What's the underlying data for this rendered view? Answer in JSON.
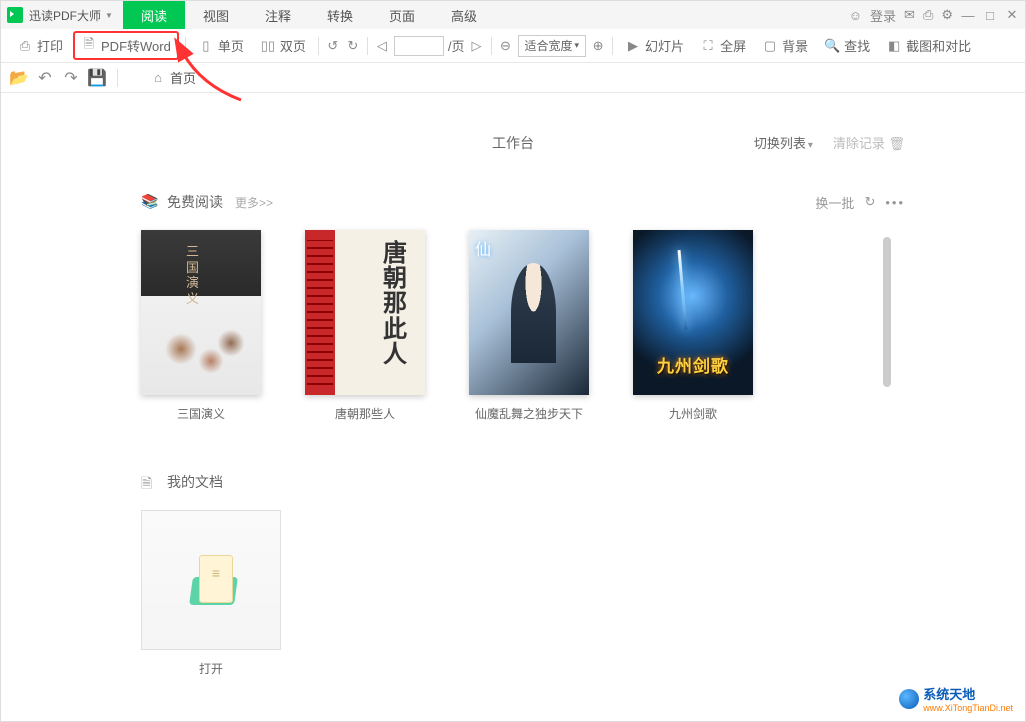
{
  "title_bar": {
    "app_name": "迅读PDF大师",
    "menu": [
      "阅读",
      "视图",
      "注释",
      "转换",
      "页面",
      "高级"
    ],
    "active_menu_index": 0,
    "login_label": "登录"
  },
  "toolbar": {
    "print": "打印",
    "pdf_to_word": "PDF转Word",
    "single_page": "单页",
    "double_page": "双页",
    "page_sep": "/页",
    "fit_width": "适合宽度",
    "slideshow": "幻灯片",
    "fullscreen": "全屏",
    "background": "背景",
    "find": "查找",
    "screenshot_compare": "截图和对比"
  },
  "sec_toolbar": {
    "home_tab": "首页"
  },
  "workspace": {
    "title": "工作台",
    "switch_list": "切换列表",
    "clear_history": "清除记录"
  },
  "free_reading": {
    "label": "免费阅读",
    "more": "更多>>",
    "refresh": "换一批",
    "books": [
      {
        "title": "三国演义"
      },
      {
        "title": "唐朝那些人"
      },
      {
        "title": "仙魔乱舞之独步天下"
      },
      {
        "title": "九州剑歌"
      }
    ]
  },
  "my_docs": {
    "label": "我的文档",
    "open": "打开"
  },
  "watermark": {
    "line1": "系统天地",
    "line2": "www.XiTongTianDi.net"
  }
}
